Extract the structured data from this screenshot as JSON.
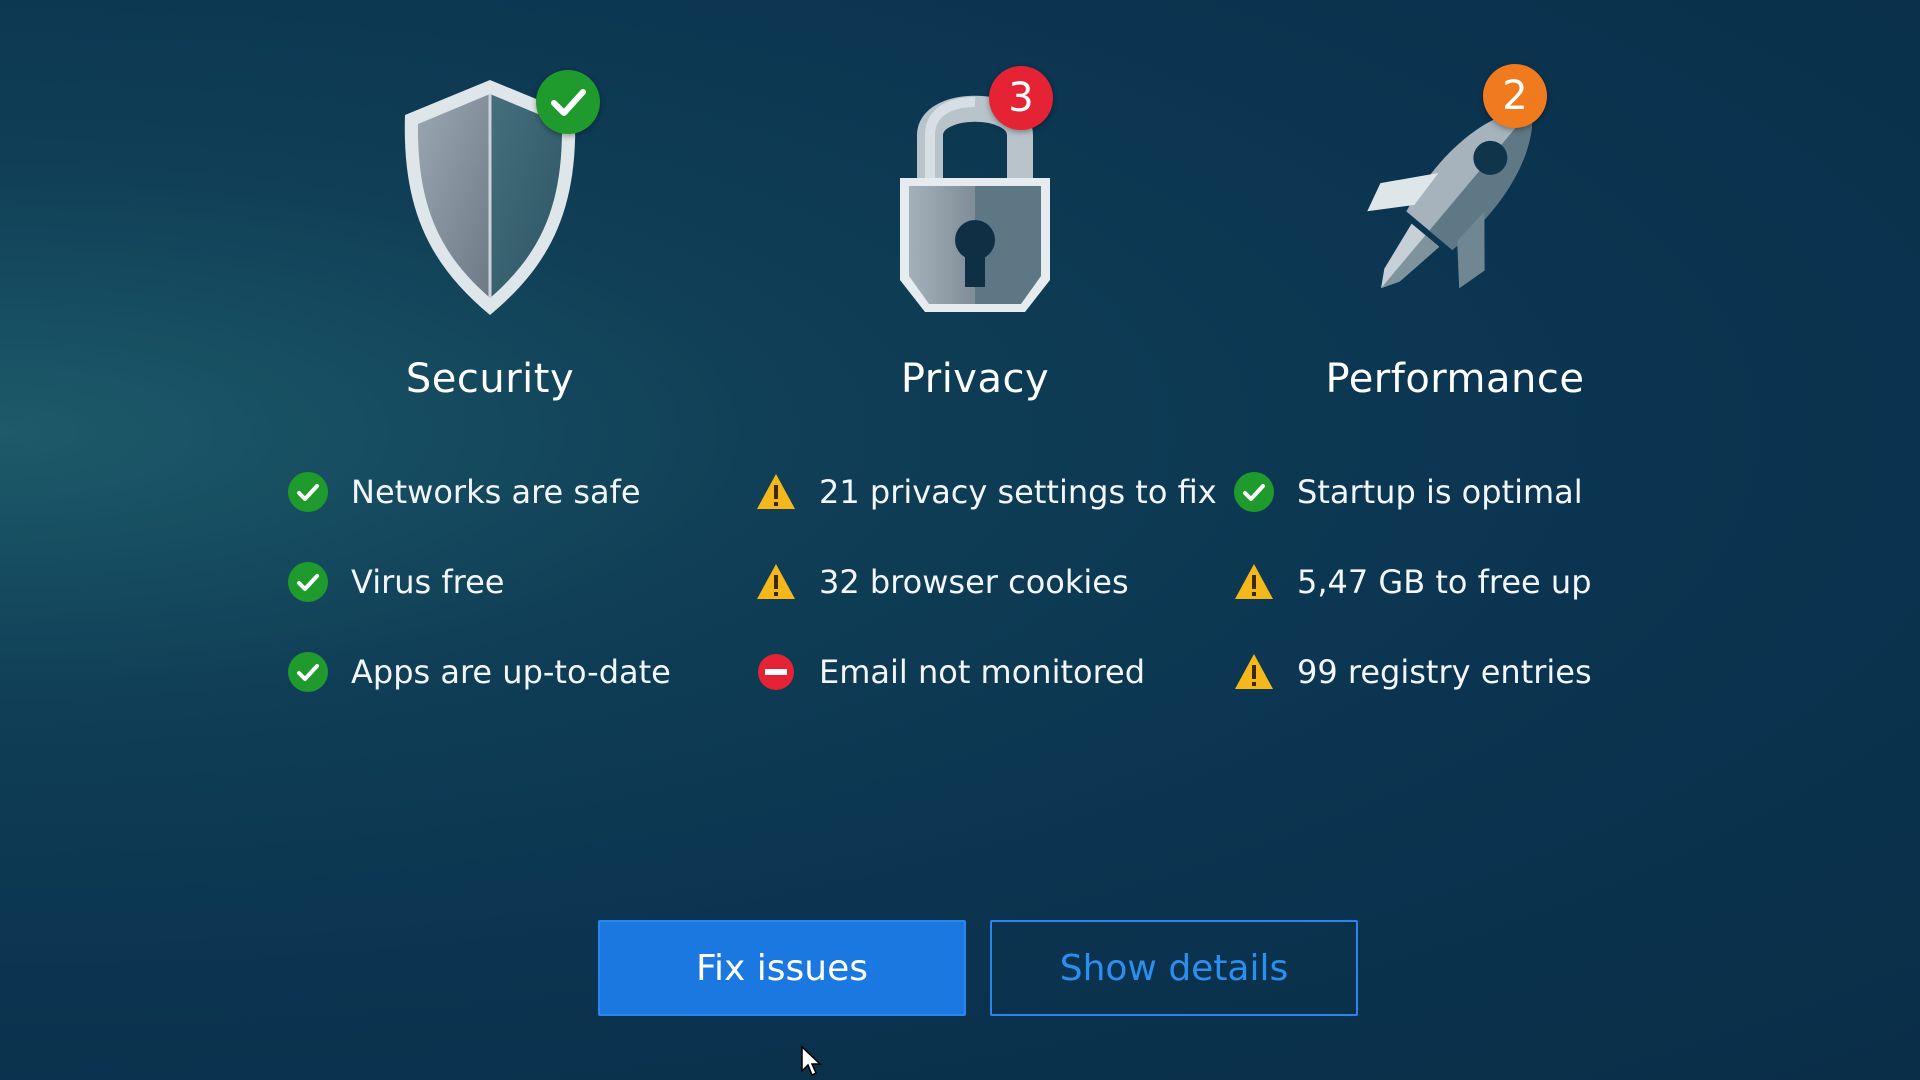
{
  "colors": {
    "background": "#0b3450",
    "ok_green": "#1f9b2d",
    "warning_yellow": "#f5b81c",
    "error_red": "#e52335",
    "badge_orange": "#f07a1e",
    "primary_blue": "#1a78e0"
  },
  "categories": [
    {
      "id": "security",
      "title": "Security",
      "icon": "shield-icon",
      "badge": {
        "type": "check",
        "text": ""
      },
      "items": [
        {
          "status": "ok",
          "icon": "check-circle-icon",
          "label": "Networks are safe"
        },
        {
          "status": "ok",
          "icon": "check-circle-icon",
          "label": "Virus free"
        },
        {
          "status": "ok",
          "icon": "check-circle-icon",
          "label": "Apps are up-to-date"
        }
      ]
    },
    {
      "id": "privacy",
      "title": "Privacy",
      "icon": "padlock-icon",
      "badge": {
        "type": "count",
        "text": "3"
      },
      "items": [
        {
          "status": "warning",
          "icon": "warning-icon",
          "label": "21 privacy settings to fix"
        },
        {
          "status": "warning",
          "icon": "warning-icon",
          "label": "32 browser cookies"
        },
        {
          "status": "error",
          "icon": "minus-circle-icon",
          "label": "Email not monitored"
        }
      ]
    },
    {
      "id": "performance",
      "title": "Performance",
      "icon": "rocket-icon",
      "badge": {
        "type": "count",
        "text": "2"
      },
      "items": [
        {
          "status": "ok",
          "icon": "check-circle-icon",
          "label": "Startup is optimal"
        },
        {
          "status": "warning",
          "icon": "warning-icon",
          "label": "5,47 GB to free up"
        },
        {
          "status": "warning",
          "icon": "warning-icon",
          "label": "99 registry entries"
        }
      ]
    }
  ],
  "actions": {
    "fix_label": "Fix issues",
    "details_label": "Show details"
  }
}
